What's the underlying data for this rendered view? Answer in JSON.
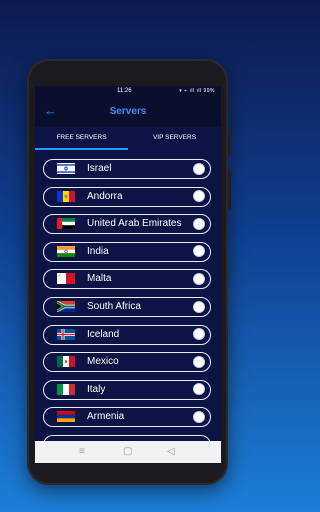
{
  "status_bar": {
    "time": "11:26",
    "icons_text": "▾ ⌁ ıll ıll 99%"
  },
  "app_bar": {
    "back_icon": "arrow-left-icon",
    "back_glyph": "←",
    "title": "Servers"
  },
  "tabs": [
    {
      "label": "FREE SERVERS",
      "selected": true
    },
    {
      "label": "VIP SERVERS",
      "selected": false
    }
  ],
  "colors": {
    "accent": "#1e9bff",
    "title": "#3d8dff",
    "background": "#0b1445"
  },
  "servers": [
    {
      "country": "Israel",
      "flag": "flag-israel"
    },
    {
      "country": "Andorra",
      "flag": "flag-andorra"
    },
    {
      "country": "United Arab Emirates",
      "flag": "flag-uae"
    },
    {
      "country": "India",
      "flag": "flag-india"
    },
    {
      "country": "Malta",
      "flag": "flag-malta"
    },
    {
      "country": "South Africa",
      "flag": "flag-south-africa"
    },
    {
      "country": "Iceland",
      "flag": "flag-iceland"
    },
    {
      "country": "Mexico",
      "flag": "flag-mexico"
    },
    {
      "country": "Italy",
      "flag": "flag-italy"
    },
    {
      "country": "Armenia",
      "flag": "flag-armenia"
    }
  ],
  "nav_bar": {
    "recents_glyph": "≡",
    "home_glyph": "▢",
    "back_glyph": "◁"
  }
}
